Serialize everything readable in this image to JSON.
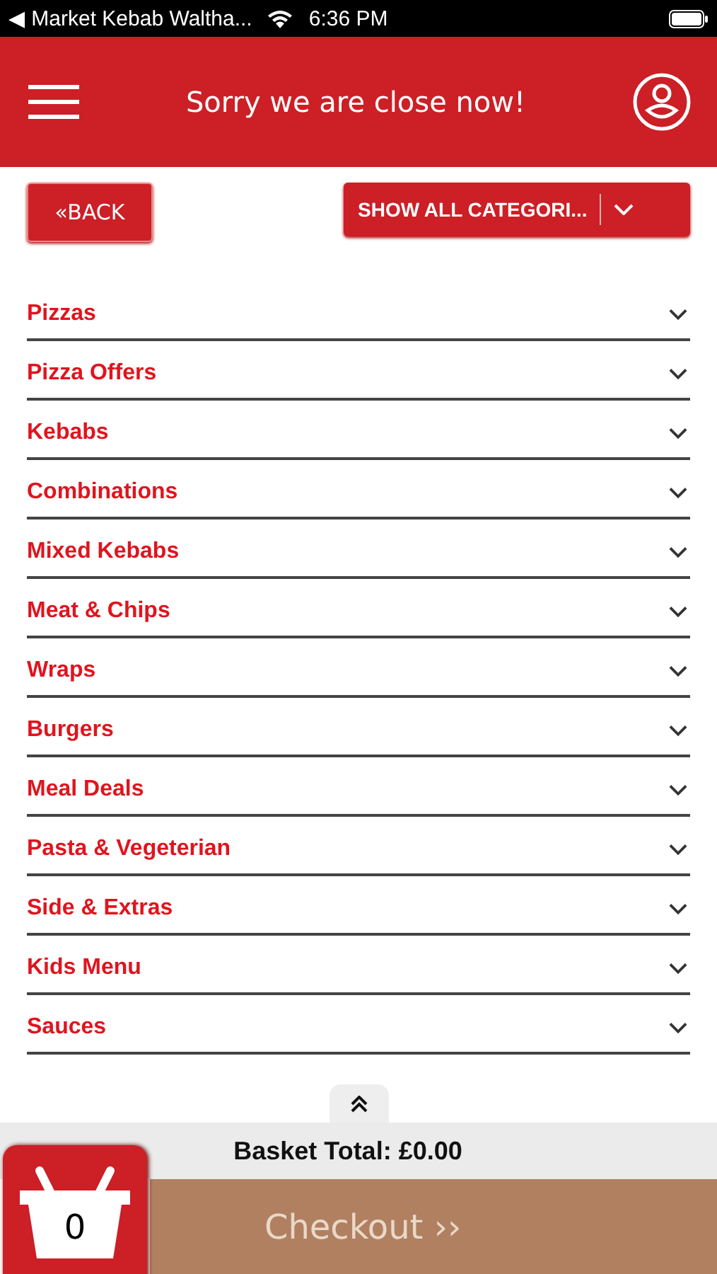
{
  "status_bar": {
    "back_app": "◀ Market Kebab Waltha...",
    "time": "6:36 PM"
  },
  "header": {
    "title": "Sorry we are close now!"
  },
  "back_button": {
    "label": "«BACK"
  },
  "category_select": {
    "value": "SHOW ALL CATEGORI..."
  },
  "categories": [
    {
      "label": "Pizzas",
      "expanded": false
    },
    {
      "label": "Pizza Offers",
      "expanded": false
    },
    {
      "label": "Kebabs",
      "expanded": false
    },
    {
      "label": "Combinations",
      "expanded": false
    },
    {
      "label": "Mixed Kebabs",
      "expanded": false
    },
    {
      "label": "Meat & Chips",
      "expanded": false
    },
    {
      "label": "Wraps",
      "expanded": false
    },
    {
      "label": "Burgers",
      "expanded": false
    },
    {
      "label": "Meal Deals",
      "expanded": false
    },
    {
      "label": "Pasta & Vegeterian",
      "expanded": false
    },
    {
      "label": "Side & Extras",
      "expanded": false
    },
    {
      "label": "Kids Menu",
      "expanded": false
    },
    {
      "label": "Sauces",
      "expanded": false
    }
  ],
  "basket": {
    "total": "Basket Total: £0.00",
    "count": "0",
    "checkout": "Checkout ››"
  }
}
